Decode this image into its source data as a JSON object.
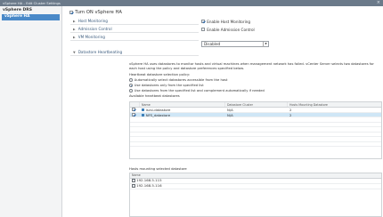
{
  "window": {
    "title": "vSphere HA - Edit Cluster Settings",
    "close_glyph": "×"
  },
  "sidebar": {
    "header": "vSphere DRS",
    "items": [
      {
        "label": "vSphere HA",
        "selected": true
      }
    ]
  },
  "main": {
    "turn_on": {
      "label": "Turn ON vSphere HA",
      "checked": true
    },
    "sections": [
      {
        "label": "Host Monitoring",
        "value_label": "Enable Host Monitoring",
        "checked": true
      },
      {
        "label": "Admission Control",
        "value_label": "Enable Admission Control",
        "checked": false
      },
      {
        "label": "VM Monitoring",
        "select_value": "Disabled"
      },
      {
        "label": "Datastore Heartbeating",
        "expanded": true
      }
    ],
    "heartbeating": {
      "description": "vSphere HA uses datastores to monitor hosts and virtual machines when management network has failed. vCenter Server selects two datastores for each host using the policy and datastore preferences specified below.",
      "policy_label": "Heartbeat datastore selection policy:",
      "options": [
        {
          "label": "Automatically select datastores accessible from the host",
          "selected": false
        },
        {
          "label": "Use datastores only from the specified list",
          "selected": true
        },
        {
          "label": "Use datastores from the specified list and complement automatically if needed",
          "selected": false
        }
      ],
      "available_label": "Available heartbeat datastores",
      "columns": {
        "name": "Name",
        "cluster": "Datastore Cluster",
        "hosts": "Hosts Mounting Datastore"
      },
      "rows": [
        {
          "name": "iscsi-datastore",
          "cluster": "N/A",
          "hosts": "2",
          "checked": true,
          "selected": false
        },
        {
          "name": "NFS_datastore",
          "cluster": "N/A",
          "hosts": "2",
          "checked": true,
          "selected": true
        }
      ],
      "hosts_label": "Hosts mounting selected datastore",
      "hosts_column": "Name",
      "hosts": [
        "192.168.5.115",
        "192.168.5.116"
      ]
    }
  }
}
